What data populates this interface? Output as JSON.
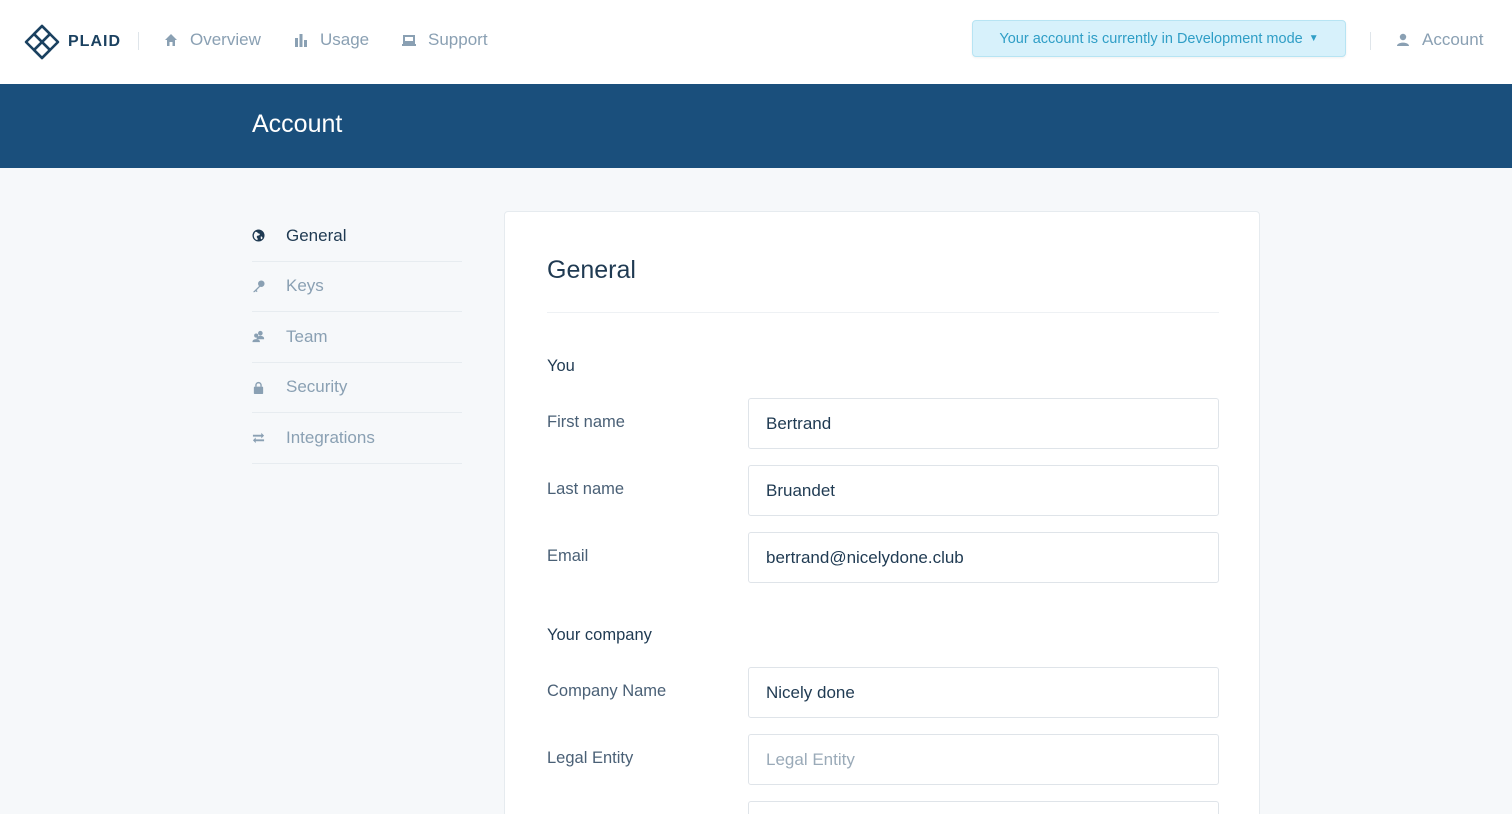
{
  "brand": {
    "name": "PLAID"
  },
  "nav": {
    "items": [
      {
        "label": "Overview",
        "icon": "home-icon"
      },
      {
        "label": "Usage",
        "icon": "bar-chart-icon"
      },
      {
        "label": "Support",
        "icon": "inbox-icon"
      }
    ],
    "dev_banner": "Your account is currently in Development mode",
    "account_label": "Account"
  },
  "header": {
    "title": "Account"
  },
  "sidebar": {
    "items": [
      {
        "label": "General",
        "icon": "globe-icon",
        "active": true
      },
      {
        "label": "Keys",
        "icon": "key-icon",
        "active": false
      },
      {
        "label": "Team",
        "icon": "team-icon",
        "active": false
      },
      {
        "label": "Security",
        "icon": "lock-icon",
        "active": false
      },
      {
        "label": "Integrations",
        "icon": "transfer-arrows-icon",
        "active": false
      }
    ]
  },
  "card": {
    "title": "General",
    "you_section": {
      "title": "You",
      "first_name": {
        "label": "First name",
        "value": "Bertrand"
      },
      "last_name": {
        "label": "Last name",
        "value": "Bruandet"
      },
      "email": {
        "label": "Email",
        "value": "bertrand@nicelydone.club"
      }
    },
    "company_section": {
      "title": "Your company",
      "company_name": {
        "label": "Company Name",
        "value": "Nicely done"
      },
      "legal_entity": {
        "label": "Legal Entity",
        "value": "",
        "placeholder": "Legal Entity"
      }
    }
  },
  "colors": {
    "brand_navy": "#1a4f7c",
    "banner_bg": "#d7f1fb",
    "banner_text": "#2f9ec6",
    "muted_text": "#8aa0b3"
  }
}
